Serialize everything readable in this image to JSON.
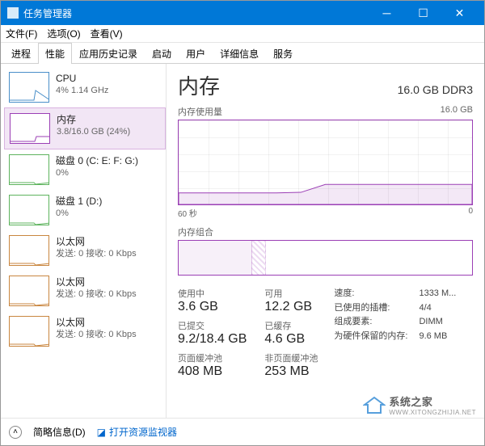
{
  "window": {
    "title": "任务管理器"
  },
  "menubar": {
    "file": "文件(F)",
    "options": "选项(O)",
    "view": "查看(V)"
  },
  "tabs": [
    "进程",
    "性能",
    "应用历史记录",
    "启动",
    "用户",
    "详细信息",
    "服务"
  ],
  "active_tab": 1,
  "sidebar": {
    "items": [
      {
        "title": "CPU",
        "sub": "4% 1.14 GHz",
        "color": "cpu"
      },
      {
        "title": "内存",
        "sub": "3.8/16.0 GB (24%)",
        "color": "mem",
        "selected": true
      },
      {
        "title": "磁盘 0 (C: E: F: G:)",
        "sub": "0%",
        "color": "disk"
      },
      {
        "title": "磁盘 1 (D:)",
        "sub": "0%",
        "color": "disk"
      },
      {
        "title": "以太网",
        "sub": "发送: 0 接收: 0 Kbps",
        "color": "eth"
      },
      {
        "title": "以太网",
        "sub": "发送: 0 接收: 0 Kbps",
        "color": "eth"
      },
      {
        "title": "以太网",
        "sub": "发送: 0 接收: 0 Kbps",
        "color": "eth"
      }
    ]
  },
  "content": {
    "title": "内存",
    "spec": "16.0 GB DDR3",
    "usage_label": "内存使用量",
    "usage_max": "16.0 GB",
    "time_left": "60 秒",
    "time_right": "0",
    "comp_label": "内存组合",
    "stats_left": [
      {
        "label": "使用中",
        "value": "3.6 GB"
      },
      {
        "label": "可用",
        "value": "12.2 GB"
      },
      {
        "label": "已提交",
        "value": "9.2/18.4 GB"
      },
      {
        "label": "已缓存",
        "value": "4.6 GB"
      },
      {
        "label": "页面缓冲池",
        "value": "408 MB"
      },
      {
        "label": "非页面缓冲池",
        "value": "253 MB"
      }
    ],
    "stats_right": [
      {
        "label": "速度:",
        "value": "1333 M..."
      },
      {
        "label": "已使用的插槽:",
        "value": "4/4"
      },
      {
        "label": "组成要素:",
        "value": "DIMM"
      },
      {
        "label": "为硬件保留的内存:",
        "value": "9.6 MB"
      }
    ]
  },
  "footer": {
    "fewer": "简略信息(D)",
    "resmon": "打开资源监视器"
  },
  "chart_data": {
    "type": "area",
    "title": "内存使用量",
    "xlabel": "秒",
    "ylabel": "GB",
    "xlim": [
      60,
      0
    ],
    "ylim": [
      0,
      16.0
    ],
    "series": [
      {
        "name": "使用中",
        "x": [
          60,
          55,
          50,
          45,
          40,
          35,
          30,
          25,
          20,
          15,
          10,
          5,
          0
        ],
        "values": [
          2.2,
          2.2,
          2.2,
          2.2,
          2.2,
          2.3,
          3.8,
          3.8,
          3.8,
          3.8,
          3.8,
          3.8,
          3.8
        ]
      }
    ]
  },
  "watermark": {
    "brand": "系统之家",
    "sub": "WWW.XITONGZHIJIA.NET"
  },
  "colors": {
    "mem": "#9b3fb5",
    "cpu": "#4a8fc9",
    "disk": "#5db35d",
    "eth": "#c9863f",
    "accent": "#0078d7"
  }
}
